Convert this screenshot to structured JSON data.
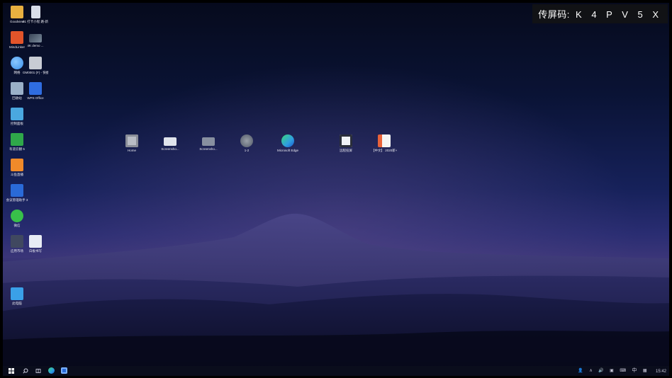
{
  "cast_overlay": {
    "label": "传屏码:",
    "code": "K 4 P V 5 X"
  },
  "left_icons": [
    {
      "name": "Goodview",
      "label": "Goodview",
      "icon": "goodview-icon",
      "color": "#e8b040"
    },
    {
      "name": "note",
      "label": "01 打卡小程 路-新建",
      "icon": "document-icon",
      "color": "#d8dde8"
    },
    {
      "name": "mindlinker",
      "label": "MindLinker",
      "icon": "mindlinker-icon",
      "color": "#e2542a"
    },
    {
      "name": "4k-demo",
      "label": "4K demo ...",
      "icon": "video-thumbnail-icon",
      "color": "#7a8a9a"
    },
    {
      "name": "network",
      "label": "网络",
      "icon": "network-globe-icon",
      "color": "#3a8ee8"
    },
    {
      "name": "gm-shortcut",
      "label": "GM0001 (F) - 快捷方式",
      "icon": "drive-icon",
      "color": "#c8ccd4"
    },
    {
      "name": "recycle-bin",
      "label": "回收站",
      "icon": "recycle-bin-icon",
      "color": "#9ab0c8"
    },
    {
      "name": "wps-office",
      "label": "WPS Office",
      "icon": "wps-icon",
      "color": "#2f6de0"
    },
    {
      "name": "control-panel",
      "label": "控制面板",
      "icon": "control-panel-icon",
      "color": "#4aa8e0"
    },
    {
      "name": "youdao-5",
      "label": "有道云翻 5",
      "icon": "en-icon",
      "color": "#2fa84a"
    },
    {
      "name": "beaver-live",
      "label": "斗鱼直播",
      "icon": "live-app-icon",
      "color": "#f08a2a"
    },
    {
      "name": "assistant",
      "label": "会议管理助手 3",
      "icon": "assistant-icon",
      "color": "#2a6ad8"
    },
    {
      "name": "wechat",
      "label": "微信",
      "icon": "wechat-icon",
      "color": "#38c04a"
    },
    {
      "name": "app-store",
      "label": "应用市场",
      "icon": "store-icon",
      "color": "#404860"
    },
    {
      "name": "whiteboard",
      "label": "白板书写",
      "icon": "pen-icon",
      "color": "#e8ecf4"
    },
    {
      "name": "this-pc",
      "label": "此电脑",
      "icon": "computer-icon",
      "color": "#3aa0e8"
    }
  ],
  "center_icons": [
    {
      "name": "home",
      "label": "Home",
      "icon": "home-folder-icon",
      "color": "#b8bcc4"
    },
    {
      "name": "screenshot-1",
      "label": "Screensho...",
      "icon": "image-thumbnail-icon",
      "color": "#e0e4ec"
    },
    {
      "name": "screenshot-2",
      "label": "Screensho...",
      "icon": "image-thumbnail-icon",
      "color": "#8890a0"
    },
    {
      "name": "file-1-2",
      "label": "1-2",
      "icon": "image-file-icon",
      "color": "#505868"
    },
    {
      "name": "edge",
      "label": "Microsoft Edge",
      "icon": "edge-icon",
      "color": "#2f9ee0"
    },
    {
      "name": "remote",
      "label": "远程投屏",
      "icon": "screen-share-icon",
      "color": "#f0f2f6"
    },
    {
      "name": "ppt-2020",
      "label": "【中文】 2020新-G...",
      "icon": "powerpoint-file-icon",
      "color": "#e8623a"
    }
  ],
  "taskbar": {
    "start_icon": "windows-start-icon",
    "search_icon": "search-icon",
    "taskview_icon": "task-view-icon",
    "pinned": [
      {
        "name": "edge",
        "icon": "edge-icon",
        "color": "#2f9ee0"
      },
      {
        "name": "assistant",
        "icon": "assistant-icon",
        "color": "#2a6ad8"
      }
    ],
    "ime_label": "中",
    "time": "15:42"
  }
}
